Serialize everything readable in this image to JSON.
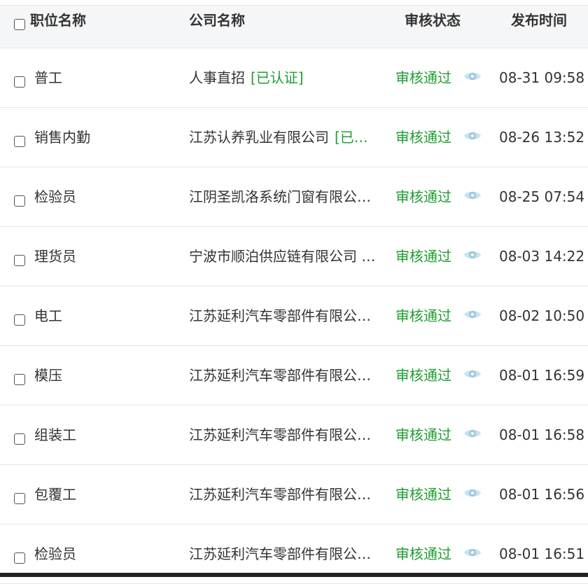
{
  "columns": {
    "title": "职位名称",
    "company": "公司名称",
    "status": "审核状态",
    "time": "发布时间"
  },
  "colors": {
    "status_green": "#1e9e2e",
    "eye_icon": "#9ec9dd"
  },
  "rows": [
    {
      "title": "普工",
      "company": "人事直招",
      "verified": "[已认证]",
      "status": "审核通过",
      "time": "08-31 09:58"
    },
    {
      "title": "销售内勤",
      "company": "江苏认养乳业有限公司",
      "verified": "[已…",
      "status": "审核通过",
      "time": "08-26 13:52"
    },
    {
      "title": "检验员",
      "company": "江阴圣凯洛系统门窗有限公…",
      "verified": "",
      "status": "审核通过",
      "time": "08-25 07:54"
    },
    {
      "title": "理货员",
      "company": "宁波市顺泊供应链有限公司 …",
      "verified": "",
      "status": "审核通过",
      "time": "08-03 14:22"
    },
    {
      "title": "电工",
      "company": "江苏延利汽车零部件有限公…",
      "verified": "",
      "status": "审核通过",
      "time": "08-02 10:50"
    },
    {
      "title": "模压",
      "company": "江苏延利汽车零部件有限公…",
      "verified": "",
      "status": "审核通过",
      "time": "08-01 16:59"
    },
    {
      "title": "组装工",
      "company": "江苏延利汽车零部件有限公…",
      "verified": "",
      "status": "审核通过",
      "time": "08-01 16:58"
    },
    {
      "title": "包覆工",
      "company": "江苏延利汽车零部件有限公…",
      "verified": "",
      "status": "审核通过",
      "time": "08-01 16:56"
    },
    {
      "title": "检验员",
      "company": "江苏延利汽车零部件有限公…",
      "verified": "",
      "status": "审核通过",
      "time": "08-01 16:51"
    }
  ]
}
